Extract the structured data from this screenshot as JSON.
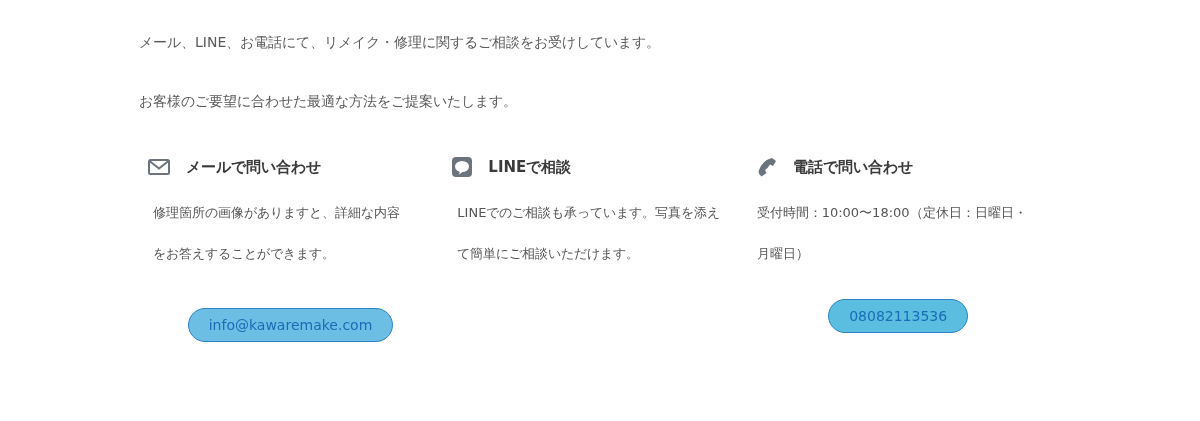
{
  "intro": [
    "メール、LINE、お電話にて、リメイク・修理に関するご相談をお受けしています。",
    "お客様のご要望に合わせた最適な方法をご提案いたします。"
  ],
  "contacts": [
    {
      "kind": "mail",
      "title": "メールで問い合わせ",
      "text": "修理箇所の画像がありますと、詳細な内容をお答えすることができます。",
      "button": "info@kawaremake.com"
    },
    {
      "kind": "line",
      "title": "LINEで相談",
      "text": "LINEでのご相談も承っています。写真を添えて簡単にご相談いただけます。"
    },
    {
      "kind": "phone",
      "title": "電話で問い合わせ",
      "text": "受付時間：10:00〜18:00（定休日：日曜日・月曜日）",
      "button": "08082113536"
    }
  ]
}
